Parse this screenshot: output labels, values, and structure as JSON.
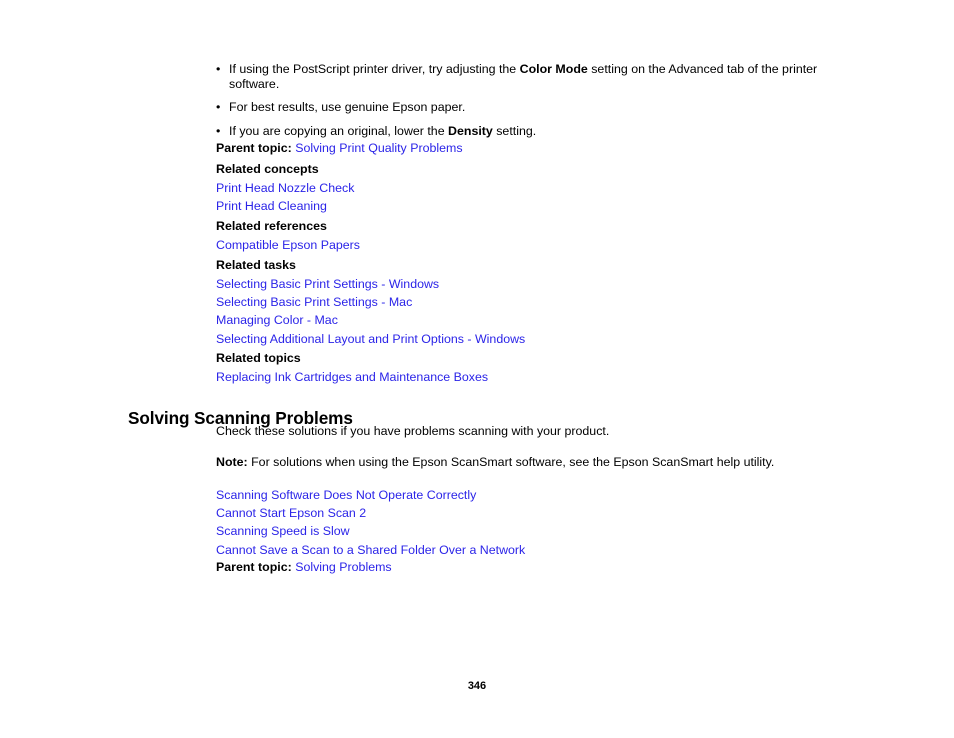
{
  "document": {
    "page_number": "346",
    "link_color": "#2b24e8",
    "text_color": "#000000",
    "background_color": "#ffffff"
  },
  "bullets": [
    {
      "marker": "•",
      "segments_text": "If using the PostScript printer driver, try adjusting the Color Mode setting on the Advanced tab of the printer software.",
      "pre": "If using the PostScript printer driver, try adjusting the ",
      "strong": "Color Mode",
      "post": " setting on the Advanced tab of the printer software."
    },
    {
      "marker": "•",
      "segments_text": "For best results, use genuine Epson paper.",
      "pre": "For best results, use genuine Epson paper.",
      "strong": "",
      "post": ""
    },
    {
      "marker": "•",
      "segments_text": "If you are copying an original, lower the Density setting.",
      "pre": "If you are copying an original, lower the ",
      "strong": "Density",
      "post": " setting."
    }
  ],
  "parent_topic_print": {
    "label": "Parent topic:",
    "link": "Solving Print Quality Problems"
  },
  "related": {
    "concepts": {
      "heading": "Related concepts",
      "links": [
        "Print Head Nozzle Check",
        "Print Head Cleaning"
      ]
    },
    "references": {
      "heading": "Related references",
      "links": [
        "Compatible Epson Papers"
      ]
    },
    "tasks": {
      "heading": "Related tasks",
      "links": [
        "Selecting Basic Print Settings - Windows",
        "Selecting Basic Print Settings - Mac",
        "Managing Color - Mac",
        "Selecting Additional Layout and Print Options - Windows"
      ]
    },
    "topics": {
      "heading": "Related topics",
      "links": [
        "Replacing Ink Cartridges and Maintenance Boxes"
      ]
    }
  },
  "scanning_section": {
    "heading": "Solving Scanning Problems",
    "intro": "Check these solutions if you have problems scanning with your product.",
    "note_label": "Note:",
    "note_text": " For solutions when using the Epson ScanSmart software, see the Epson ScanSmart help utility.",
    "links": [
      "Scanning Software Does Not Operate Correctly",
      "Cannot Start Epson Scan 2",
      "Scanning Speed is Slow",
      "Cannot Save a Scan to a Shared Folder Over a Network"
    ],
    "parent_topic": {
      "label": "Parent topic:",
      "link": "Solving Problems"
    }
  }
}
